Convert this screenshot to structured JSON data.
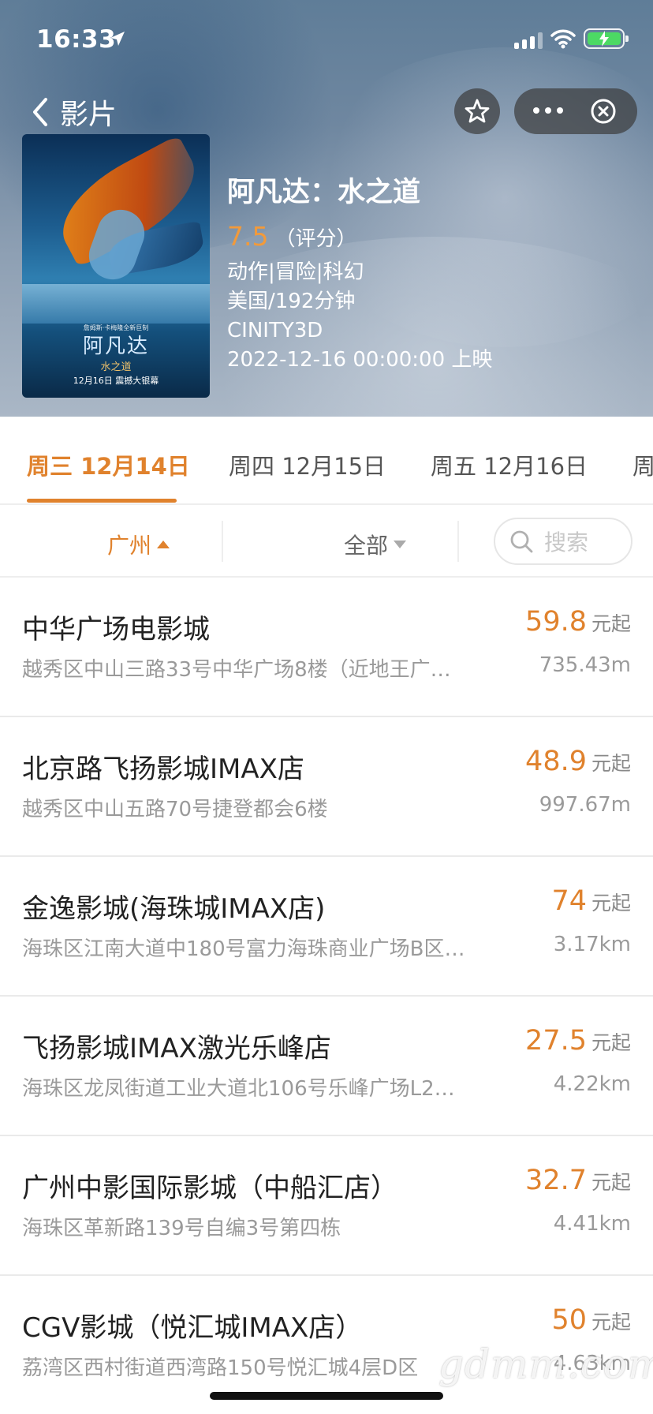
{
  "status_bar": {
    "time": "16:33"
  },
  "nav": {
    "back_label": "影片"
  },
  "movie": {
    "title": "阿凡达：水之道",
    "score": "7.5",
    "score_label": "（评分）",
    "genres": "动作|冒险|科幻",
    "region_duration": "美国/192分钟",
    "format": "CINITY3D",
    "release": "2022-12-16 00:00:00 上映",
    "poster": {
      "top_text": "詹姆斯·卡梅隆全新巨制",
      "title": "阿凡达",
      "subtitle": "水之道",
      "date": "12月16日 震撼大银幕"
    }
  },
  "date_tabs": [
    {
      "label": "周三 12月14日",
      "active": true
    },
    {
      "label": "周四 12月15日",
      "active": false
    },
    {
      "label": "周五 12月16日",
      "active": false
    },
    {
      "label": "周",
      "active": false
    }
  ],
  "filters": {
    "city": "广州",
    "category": "全部",
    "search_placeholder": "搜索"
  },
  "price_unit": "元起",
  "cinemas": [
    {
      "name": "中华广场电影城",
      "address": "越秀区中山三路33号中华广场8楼（近地王广…",
      "price": "59.8",
      "distance": "735.43m"
    },
    {
      "name": "北京路飞扬影城IMAX店",
      "address": "越秀区中山五路70号捷登都会6楼",
      "price": "48.9",
      "distance": "997.67m"
    },
    {
      "name": "金逸影城(海珠城IMAX店)",
      "address": "海珠区江南大道中180号富力海珠商业广场B区…",
      "price": "74",
      "distance": "3.17km"
    },
    {
      "name": "飞扬影城IMAX激光乐峰店",
      "address": "海珠区龙凤街道工业大道北106号乐峰广场L2…",
      "price": "27.5",
      "distance": "4.22km"
    },
    {
      "name": "广州中影国际影城（中船汇店）",
      "address": "海珠区革新路139号自编3号第四栋",
      "price": "32.7",
      "distance": "4.41km"
    },
    {
      "name": "CGV影城（悦汇城IMAX店）",
      "address": "荔湾区西村街道西湾路150号悦汇城4层D区",
      "price": "50",
      "distance": "4.63km"
    }
  ],
  "watermark": "gdmm.com",
  "colors": {
    "accent": "#e0822d",
    "rating": "#f29a3a"
  }
}
